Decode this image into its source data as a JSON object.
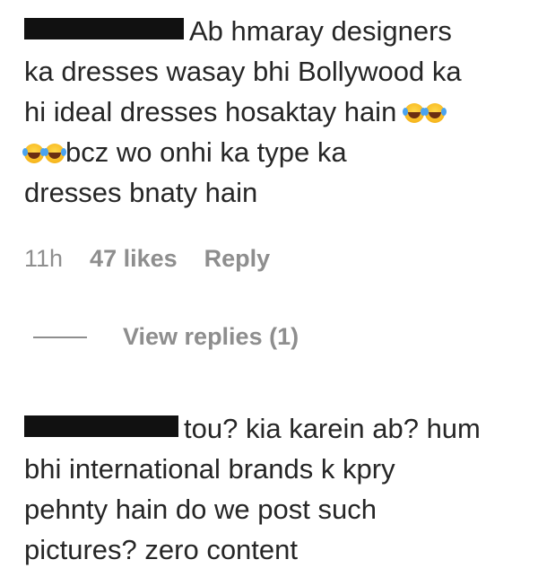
{
  "comments": [
    {
      "username_redacted": true,
      "text_line1": "Ab hmaray designers",
      "text_line2": "ka dresses wasay bhi Bollywood ka",
      "text_line3": "hi ideal dresses hosaktay hain",
      "text_line4": "bcz wo onhi ka type ka",
      "text_line5": "dresses bnaty hain",
      "emoji": "face-with-tears-of-joy-icon",
      "time": "11h",
      "likes": "47 likes",
      "reply_label": "Reply",
      "view_replies_label": "View replies (1)"
    },
    {
      "username_redacted": true,
      "text_line1": "tou? kia karein ab? hum",
      "text_line2": "bhi international brands k kpry",
      "text_line3": "pehnty hain do we post such",
      "text_line4": "pictures? zero content"
    }
  ],
  "colors": {
    "text": "#262626",
    "meta": "#8e8e8e",
    "redaction": "#111111"
  }
}
